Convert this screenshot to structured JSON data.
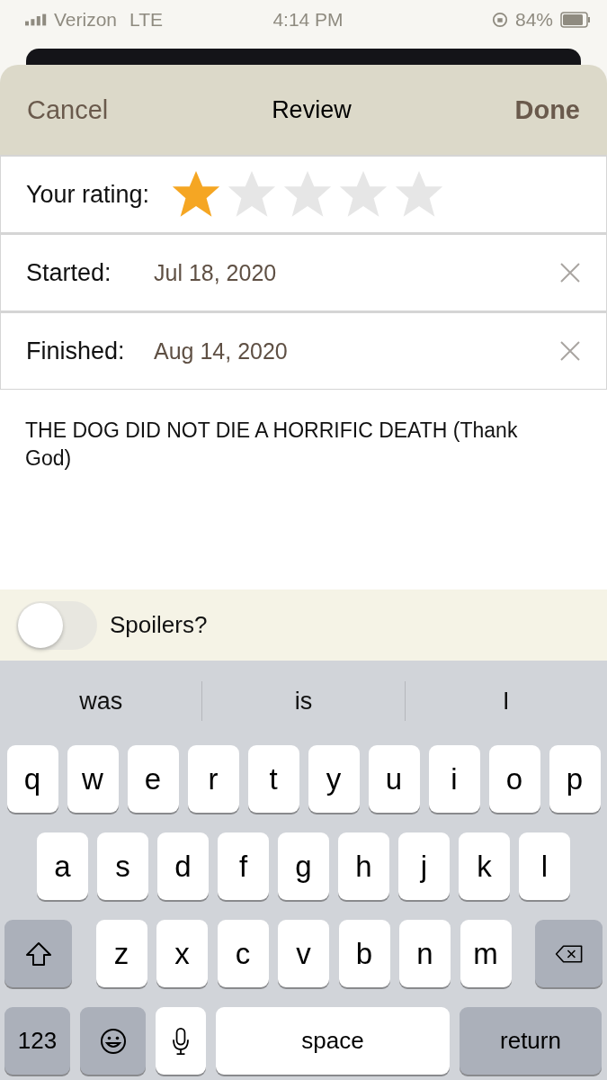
{
  "status_bar": {
    "carrier": "Verizon",
    "network": "LTE",
    "time": "4:14 PM",
    "battery": "84%"
  },
  "nav": {
    "cancel": "Cancel",
    "title": "Review",
    "done": "Done"
  },
  "rating": {
    "label": "Your rating:",
    "stars": 1
  },
  "dates": [
    {
      "label": "Started:",
      "value": "Jul 18, 2020"
    },
    {
      "label": "Finished:",
      "value": "Aug 14, 2020"
    }
  ],
  "review_text": "THE DOG DID NOT DIE A HORRIFIC DEATH (Thank God)",
  "spoilers": {
    "label": "Spoilers?",
    "on": false
  },
  "keyboard": {
    "suggestions": [
      "was",
      "is",
      "I"
    ],
    "key_rows": [
      {
        "keys": [
          {
            "kind": "letter",
            "label": "q"
          },
          {
            "kind": "letter",
            "label": "w"
          },
          {
            "kind": "letter",
            "label": "e"
          },
          {
            "kind": "letter",
            "label": "r"
          },
          {
            "kind": "letter",
            "label": "t"
          },
          {
            "kind": "letter",
            "label": "y"
          },
          {
            "kind": "letter",
            "label": "u"
          },
          {
            "kind": "letter",
            "label": "i"
          },
          {
            "kind": "letter",
            "label": "o"
          },
          {
            "kind": "letter",
            "label": "p"
          }
        ]
      },
      {
        "keys": [
          {
            "kind": "letter",
            "label": "a"
          },
          {
            "kind": "letter",
            "label": "s"
          },
          {
            "kind": "letter",
            "label": "d"
          },
          {
            "kind": "letter",
            "label": "f"
          },
          {
            "kind": "letter",
            "label": "g"
          },
          {
            "kind": "letter",
            "label": "h"
          },
          {
            "kind": "letter",
            "label": "j"
          },
          {
            "kind": "letter",
            "label": "k"
          },
          {
            "kind": "letter",
            "label": "l"
          }
        ]
      },
      {
        "keys": [
          {
            "kind": "shift"
          },
          {
            "kind": "letter",
            "label": "z"
          },
          {
            "kind": "letter",
            "label": "x"
          },
          {
            "kind": "letter",
            "label": "c"
          },
          {
            "kind": "letter",
            "label": "v"
          },
          {
            "kind": "letter",
            "label": "b"
          },
          {
            "kind": "letter",
            "label": "n"
          },
          {
            "kind": "letter",
            "label": "m"
          },
          {
            "kind": "delete"
          }
        ]
      },
      {
        "keys": [
          {
            "kind": "mode",
            "label": "123"
          },
          {
            "kind": "emoji"
          },
          {
            "kind": "mic"
          },
          {
            "kind": "space",
            "label": "space"
          },
          {
            "kind": "return",
            "label": "return"
          }
        ]
      }
    ]
  }
}
